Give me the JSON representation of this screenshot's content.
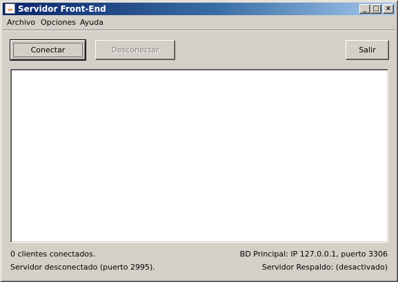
{
  "window": {
    "title": "Servidor Front-End",
    "app_icon": "java-cup-icon",
    "controls": {
      "minimize": "_",
      "maximize": "□",
      "close": "×"
    }
  },
  "menu": {
    "items": [
      {
        "label": "Archivo"
      },
      {
        "label": "Opciones"
      },
      {
        "label": "Ayuda"
      }
    ]
  },
  "toolbar": {
    "connect_label": "Conectar",
    "disconnect_label": "Desconectar",
    "disconnect_enabled": false,
    "exit_label": "Salir"
  },
  "log": {
    "lines": []
  },
  "status": {
    "clients": "0 clientes conectados.",
    "server": "Servidor desconectado (puerto 2995).",
    "db_primary": "BD Principal: IP 127.0.0.1, puerto 3306",
    "backup_server": "Servidor Respaldo: (desactivado)"
  }
}
